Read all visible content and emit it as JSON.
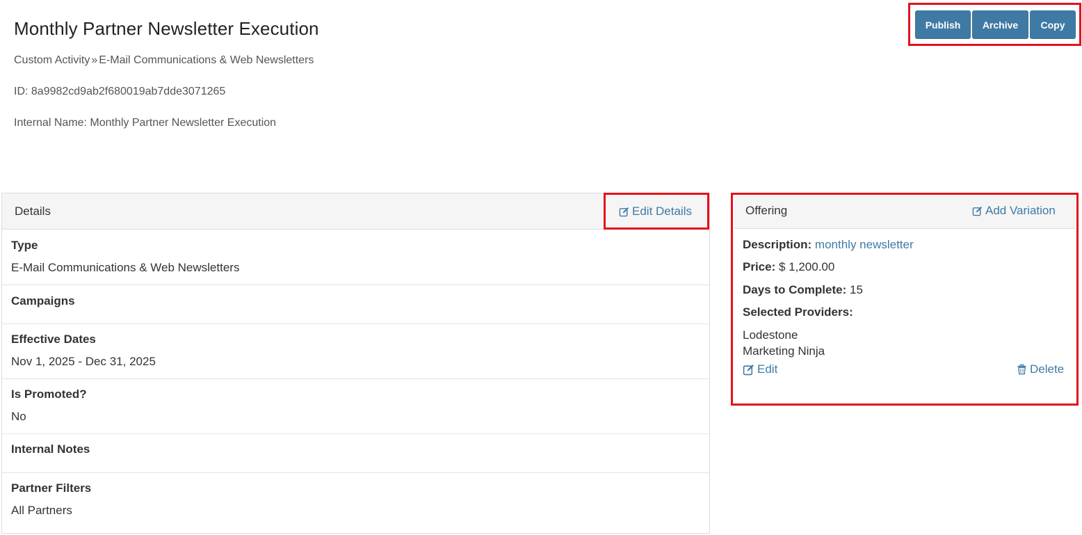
{
  "page": {
    "title": "Monthly Partner Newsletter Execution",
    "breadcrumb": {
      "parent": "Custom Activity",
      "separator": "»",
      "current": "E-Mail Communications & Web Newsletters"
    },
    "id_line": "ID: 8a9982cd9ab2f680019ab7dde3071265",
    "internal_name_line": "Internal Name: Monthly Partner Newsletter Execution"
  },
  "actions": {
    "publish": "Publish",
    "archive": "Archive",
    "copy": "Copy"
  },
  "details": {
    "header": "Details",
    "edit_label": "Edit Details",
    "rows": [
      {
        "label": "Type",
        "value": "E-Mail Communications & Web Newsletters"
      },
      {
        "label": "Campaigns",
        "value": ""
      },
      {
        "label": "Effective Dates",
        "value": "Nov 1, 2025 - Dec 31, 2025"
      },
      {
        "label": "Is Promoted?",
        "value": "No"
      },
      {
        "label": "Internal Notes",
        "value": ""
      },
      {
        "label": "Partner Filters",
        "value": "All Partners"
      }
    ]
  },
  "offering": {
    "header": "Offering",
    "add_variation_label": "Add Variation",
    "description_label": "Description:",
    "description_value": "monthly newsletter",
    "price_label": "Price:",
    "price_value": "$ 1,200.00",
    "days_label": "Days to Complete:",
    "days_value": "15",
    "providers_label": "Selected Providers:",
    "providers": [
      "Lodestone",
      "Marketing Ninja"
    ],
    "edit_label": "Edit",
    "delete_label": "Delete"
  },
  "colors": {
    "accent": "#3f7aa5",
    "highlight_box": "#e3121b",
    "panel_header_bg": "#f5f5f5"
  },
  "icons": {
    "edit": "edit-icon",
    "delete": "trash-icon"
  }
}
